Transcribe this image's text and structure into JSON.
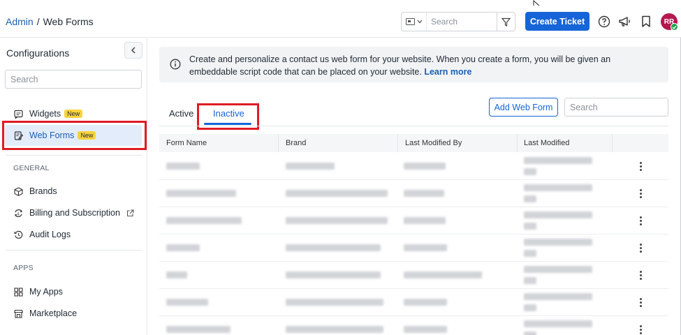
{
  "header": {
    "breadcrumb_root": "Admin",
    "breadcrumb_sep": "/",
    "breadcrumb_current": "Web Forms",
    "search_placeholder": "Search",
    "create_ticket_label": "Create Ticket",
    "avatar_initials": "RR"
  },
  "sidebar": {
    "title": "Configurations",
    "search_placeholder": "Search",
    "items": [
      {
        "label": "Widgets",
        "badge": "New",
        "icon": "widget-icon"
      },
      {
        "label": "Web Forms",
        "badge": "New",
        "icon": "form-icon",
        "active": true
      }
    ],
    "general_label": "GENERAL",
    "general_items": [
      {
        "label": "Brands",
        "icon": "cube-icon"
      },
      {
        "label": "Billing and Subscription",
        "icon": "billing-icon"
      },
      {
        "label": "Audit Logs",
        "icon": "history-icon"
      }
    ],
    "apps_label": "APPS",
    "apps_items": [
      {
        "label": "My Apps",
        "icon": "grid-icon"
      },
      {
        "label": "Marketplace",
        "icon": "store-icon"
      }
    ]
  },
  "banner": {
    "text": "Create and personalize a contact us web form for your website. When you create a form, you will be given an embeddable script code that can be placed on your website.",
    "link": "Learn more"
  },
  "tabs": [
    {
      "label": "Active"
    },
    {
      "label": "Inactive",
      "active": true
    }
  ],
  "actions": {
    "add_label": "Add Web Form",
    "search_placeholder": "Search"
  },
  "table": {
    "columns": [
      "Form Name",
      "Brand",
      "Last Modified By",
      "Last Modified"
    ],
    "row_count": 7
  },
  "colors": {
    "accent": "#1565d8",
    "highlight": "#e01b24",
    "badge": "#f6d33c",
    "avatar": "#b5174f"
  }
}
